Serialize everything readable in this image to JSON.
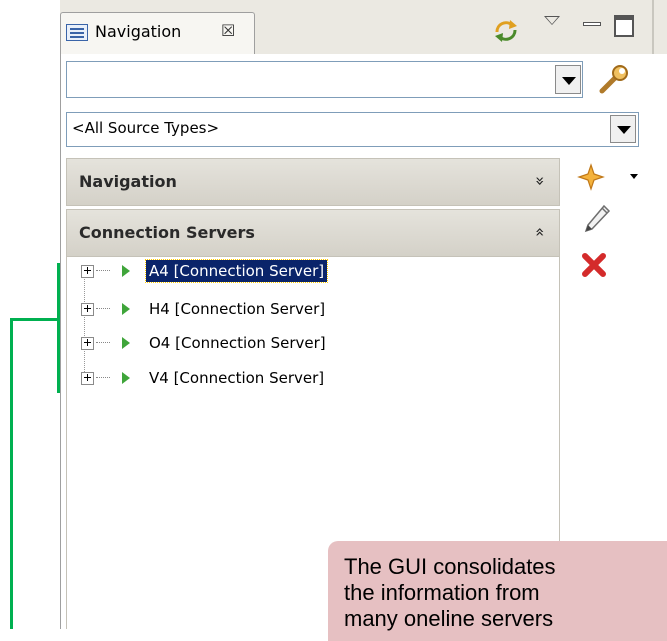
{
  "view_tab": {
    "title": "Navigation",
    "close_glyph": "☒",
    "icons": [
      "navigation-view-icon",
      "sync-icon",
      "view-menu-icon",
      "minimize-icon",
      "maximize-icon"
    ]
  },
  "search": {
    "value": "",
    "tool_icon": "search-wrench-icon"
  },
  "source_type": {
    "selected": "<All Source Types>"
  },
  "sections": {
    "navigation": {
      "title": "Navigation",
      "chevron": "»"
    },
    "connection_servers": {
      "title": "Connection Servers",
      "chevron": "«"
    }
  },
  "tree": {
    "items": [
      {
        "label": "A4 [Connection Server]",
        "selected": true
      },
      {
        "label": "H4 [Connection Server]",
        "selected": false
      },
      {
        "label": "O4 [Connection Server]",
        "selected": false
      },
      {
        "label": "V4 [Connection Server]",
        "selected": false
      }
    ]
  },
  "toolbar": {
    "icons": [
      "new-star-icon",
      "edit-pencil-icon",
      "delete-x-icon"
    ]
  },
  "colors": {
    "selection": "#0a246a",
    "annotation_green": "#00b050",
    "callout_bg": "#e6c0c2",
    "status_green": "#3fa53a"
  },
  "callout": {
    "text": "The GUI consolidates\nthe information from\nmany oneline servers"
  }
}
